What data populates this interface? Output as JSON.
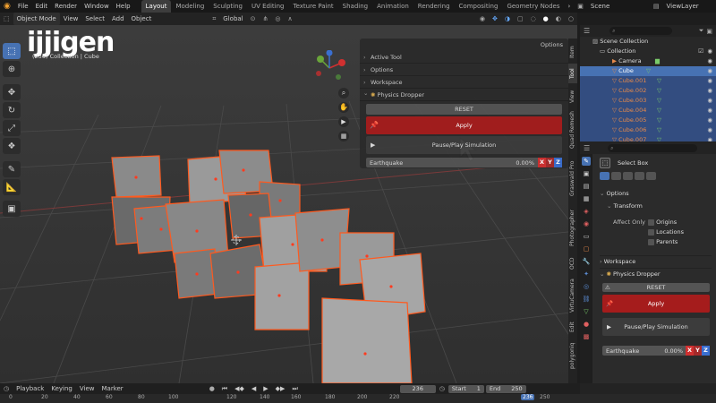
{
  "menu": {
    "items": [
      "File",
      "Edit",
      "Render",
      "Window",
      "Help"
    ],
    "workspaces": [
      "Layout",
      "Modeling",
      "Sculpting",
      "UV Editing",
      "Texture Paint",
      "Shading",
      "Animation",
      "Rendering",
      "Compositing",
      "Geometry Nodes"
    ],
    "active_workspace": "Layout",
    "scene": "Scene",
    "view_layer": "ViewLayer"
  },
  "viewport_header": {
    "mode": "Object Mode",
    "menus": [
      "View",
      "Select",
      "Add",
      "Object"
    ],
    "orientation": "Global",
    "options": "Options"
  },
  "viewport_overlay": {
    "watermark": "ijjigen",
    "info_prefix": "(236)",
    "info_collection": "Collection | Cube"
  },
  "npanel": {
    "sections": [
      "Active Tool",
      "Options",
      "Workspace"
    ],
    "addon_title": "Physics Dropper",
    "reset_label": "RESET",
    "apply_label": "Apply",
    "pause_label": "Pause/Play Simulation",
    "earthquake_label": "Earthquake",
    "earthquake_value": "0.00%",
    "axes": [
      "X",
      "Y",
      "Z"
    ]
  },
  "npanel_tabs": [
    "Item",
    "Tool",
    "View",
    "Quad Remesh",
    "Graswald Pro",
    "Photographer",
    "OCD",
    "VirtuCamera",
    "Edit",
    "polygoniq"
  ],
  "outliner": {
    "root": "Scene Collection",
    "collection": "Collection",
    "objects": [
      "Camera",
      "Cube",
      "Cube.001",
      "Cube.002",
      "Cube.003",
      "Cube.004",
      "Cube.005",
      "Cube.006",
      "Cube.007"
    ]
  },
  "properties": {
    "tool_label": "Select Box",
    "options_label": "Options",
    "transform_label": "Transform",
    "affect_only_label": "Affect Only",
    "checkboxes": [
      "Origins",
      "Locations",
      "Parents"
    ],
    "workspace_label": "Workspace",
    "addon_title": "Physics Dropper",
    "reset_label": "RESET",
    "apply_label": "Apply",
    "pause_label": "Pause/Play Simulation",
    "earthquake_label": "Earthquake",
    "earthquake_value": "0.00%",
    "axes": [
      "X",
      "Y",
      "Z"
    ]
  },
  "timeline": {
    "menus": [
      "Playback",
      "Keying",
      "View",
      "Marker"
    ],
    "current_frame": "236",
    "start_label": "Start",
    "start_value": "1",
    "end_label": "End",
    "end_value": "250",
    "ruler_ticks": [
      "0",
      "20",
      "40",
      "60",
      "80",
      "100",
      "120",
      "140",
      "160",
      "180",
      "200",
      "220",
      "236",
      "250"
    ]
  },
  "colors": {
    "accent": "#4772b3",
    "apply_red": "#a51c1c",
    "selection_orange": "#ff5a1f",
    "axis_x": "#d03030",
    "axis_y": "#6aa53a",
    "axis_z": "#3a6fd0"
  }
}
